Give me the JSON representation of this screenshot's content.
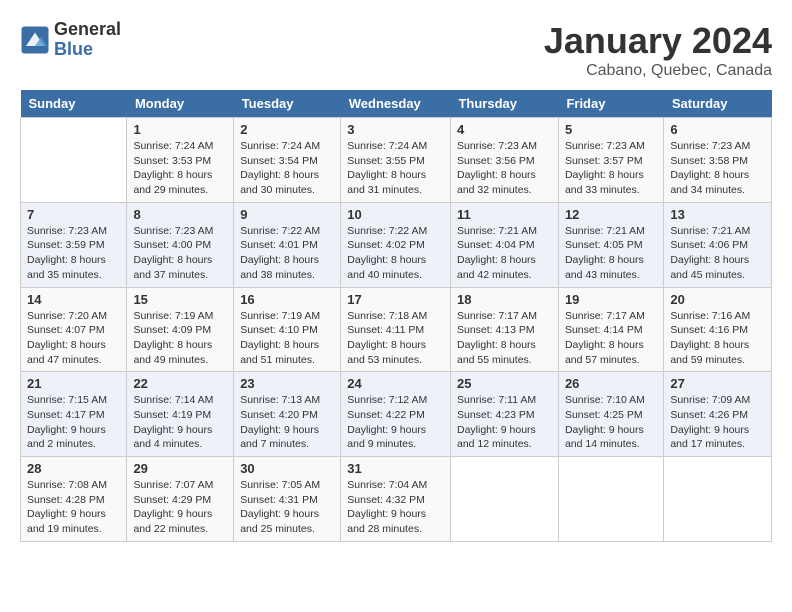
{
  "header": {
    "logo_general": "General",
    "logo_blue": "Blue",
    "title": "January 2024",
    "subtitle": "Cabano, Quebec, Canada"
  },
  "weekdays": [
    "Sunday",
    "Monday",
    "Tuesday",
    "Wednesday",
    "Thursday",
    "Friday",
    "Saturday"
  ],
  "weeks": [
    [
      {
        "day": "",
        "info": ""
      },
      {
        "day": "1",
        "info": "Sunrise: 7:24 AM\nSunset: 3:53 PM\nDaylight: 8 hours\nand 29 minutes."
      },
      {
        "day": "2",
        "info": "Sunrise: 7:24 AM\nSunset: 3:54 PM\nDaylight: 8 hours\nand 30 minutes."
      },
      {
        "day": "3",
        "info": "Sunrise: 7:24 AM\nSunset: 3:55 PM\nDaylight: 8 hours\nand 31 minutes."
      },
      {
        "day": "4",
        "info": "Sunrise: 7:23 AM\nSunset: 3:56 PM\nDaylight: 8 hours\nand 32 minutes."
      },
      {
        "day": "5",
        "info": "Sunrise: 7:23 AM\nSunset: 3:57 PM\nDaylight: 8 hours\nand 33 minutes."
      },
      {
        "day": "6",
        "info": "Sunrise: 7:23 AM\nSunset: 3:58 PM\nDaylight: 8 hours\nand 34 minutes."
      }
    ],
    [
      {
        "day": "7",
        "info": "Sunrise: 7:23 AM\nSunset: 3:59 PM\nDaylight: 8 hours\nand 35 minutes."
      },
      {
        "day": "8",
        "info": "Sunrise: 7:23 AM\nSunset: 4:00 PM\nDaylight: 8 hours\nand 37 minutes."
      },
      {
        "day": "9",
        "info": "Sunrise: 7:22 AM\nSunset: 4:01 PM\nDaylight: 8 hours\nand 38 minutes."
      },
      {
        "day": "10",
        "info": "Sunrise: 7:22 AM\nSunset: 4:02 PM\nDaylight: 8 hours\nand 40 minutes."
      },
      {
        "day": "11",
        "info": "Sunrise: 7:21 AM\nSunset: 4:04 PM\nDaylight: 8 hours\nand 42 minutes."
      },
      {
        "day": "12",
        "info": "Sunrise: 7:21 AM\nSunset: 4:05 PM\nDaylight: 8 hours\nand 43 minutes."
      },
      {
        "day": "13",
        "info": "Sunrise: 7:21 AM\nSunset: 4:06 PM\nDaylight: 8 hours\nand 45 minutes."
      }
    ],
    [
      {
        "day": "14",
        "info": "Sunrise: 7:20 AM\nSunset: 4:07 PM\nDaylight: 8 hours\nand 47 minutes."
      },
      {
        "day": "15",
        "info": "Sunrise: 7:19 AM\nSunset: 4:09 PM\nDaylight: 8 hours\nand 49 minutes."
      },
      {
        "day": "16",
        "info": "Sunrise: 7:19 AM\nSunset: 4:10 PM\nDaylight: 8 hours\nand 51 minutes."
      },
      {
        "day": "17",
        "info": "Sunrise: 7:18 AM\nSunset: 4:11 PM\nDaylight: 8 hours\nand 53 minutes."
      },
      {
        "day": "18",
        "info": "Sunrise: 7:17 AM\nSunset: 4:13 PM\nDaylight: 8 hours\nand 55 minutes."
      },
      {
        "day": "19",
        "info": "Sunrise: 7:17 AM\nSunset: 4:14 PM\nDaylight: 8 hours\nand 57 minutes."
      },
      {
        "day": "20",
        "info": "Sunrise: 7:16 AM\nSunset: 4:16 PM\nDaylight: 8 hours\nand 59 minutes."
      }
    ],
    [
      {
        "day": "21",
        "info": "Sunrise: 7:15 AM\nSunset: 4:17 PM\nDaylight: 9 hours\nand 2 minutes."
      },
      {
        "day": "22",
        "info": "Sunrise: 7:14 AM\nSunset: 4:19 PM\nDaylight: 9 hours\nand 4 minutes."
      },
      {
        "day": "23",
        "info": "Sunrise: 7:13 AM\nSunset: 4:20 PM\nDaylight: 9 hours\nand 7 minutes."
      },
      {
        "day": "24",
        "info": "Sunrise: 7:12 AM\nSunset: 4:22 PM\nDaylight: 9 hours\nand 9 minutes."
      },
      {
        "day": "25",
        "info": "Sunrise: 7:11 AM\nSunset: 4:23 PM\nDaylight: 9 hours\nand 12 minutes."
      },
      {
        "day": "26",
        "info": "Sunrise: 7:10 AM\nSunset: 4:25 PM\nDaylight: 9 hours\nand 14 minutes."
      },
      {
        "day": "27",
        "info": "Sunrise: 7:09 AM\nSunset: 4:26 PM\nDaylight: 9 hours\nand 17 minutes."
      }
    ],
    [
      {
        "day": "28",
        "info": "Sunrise: 7:08 AM\nSunset: 4:28 PM\nDaylight: 9 hours\nand 19 minutes."
      },
      {
        "day": "29",
        "info": "Sunrise: 7:07 AM\nSunset: 4:29 PM\nDaylight: 9 hours\nand 22 minutes."
      },
      {
        "day": "30",
        "info": "Sunrise: 7:05 AM\nSunset: 4:31 PM\nDaylight: 9 hours\nand 25 minutes."
      },
      {
        "day": "31",
        "info": "Sunrise: 7:04 AM\nSunset: 4:32 PM\nDaylight: 9 hours\nand 28 minutes."
      },
      {
        "day": "",
        "info": ""
      },
      {
        "day": "",
        "info": ""
      },
      {
        "day": "",
        "info": ""
      }
    ]
  ]
}
